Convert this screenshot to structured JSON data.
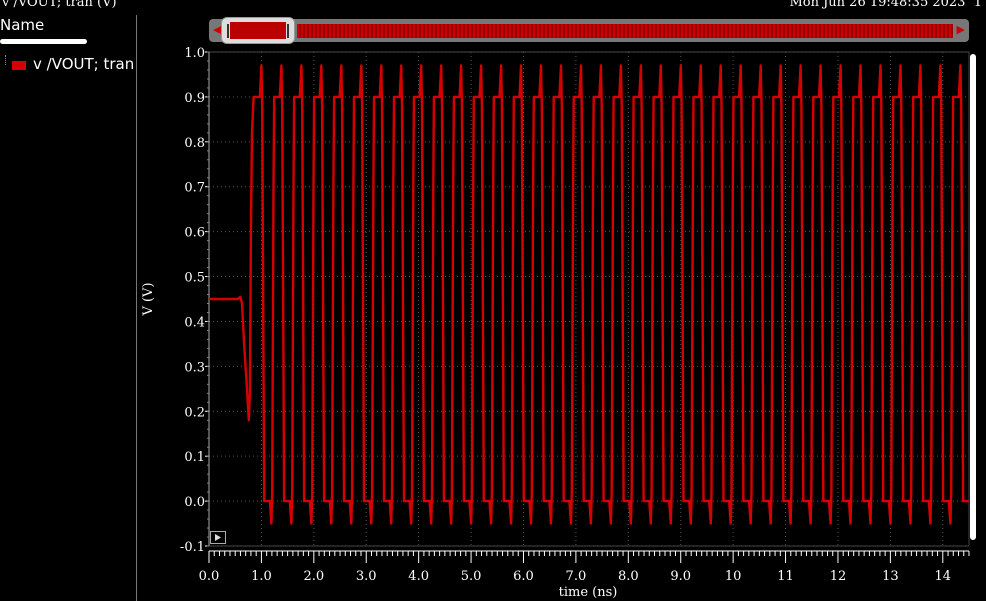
{
  "header": {
    "trace_title": "v /VOUT; tran (V)",
    "timestamp": "Mon Jun 26 19:48:35 2023",
    "page_indicator": "1"
  },
  "legend": {
    "column_header": "Name",
    "items": [
      {
        "label": "v /VOUT; tran",
        "color": "#d50000"
      }
    ]
  },
  "chart_data": {
    "type": "line",
    "xlabel": "time (ns)",
    "ylabel": "V (V)",
    "xlim": [
      0,
      14.5
    ],
    "ylim": [
      -0.1,
      1.0
    ],
    "x_ticks": [
      0.0,
      1.0,
      2.0,
      3.0,
      4.0,
      5.0,
      6.0,
      7.0,
      8.0,
      9.0,
      10,
      11,
      12,
      13,
      14
    ],
    "x_tick_labels": [
      "0.0",
      "1.0",
      "2.0",
      "3.0",
      "4.0",
      "5.0",
      "6.0",
      "7.0",
      "8.0",
      "9.0",
      "10",
      "11",
      "12",
      "13",
      "14"
    ],
    "y_ticks": [
      -0.1,
      0.0,
      0.1,
      0.2,
      0.3,
      0.4,
      0.5,
      0.6,
      0.7,
      0.8,
      0.9,
      1.0
    ],
    "y_tick_labels": [
      "-0.1",
      "0.0",
      "0.1",
      "0.2",
      "0.3",
      "0.4",
      "0.5",
      "0.6",
      "0.7",
      "0.8",
      "0.9",
      "1.0"
    ],
    "grid": true,
    "series": [
      {
        "name": "v /VOUT; tran",
        "color": "#d50000",
        "initial_level": 0.45,
        "startup_dip": 0.18,
        "startup_end": 0.85,
        "period": 0.381,
        "high_level": 0.9,
        "high_overshoot": 0.97,
        "low_level": 0.0,
        "low_undershoot": -0.05,
        "duty": 0.5
      }
    ]
  }
}
